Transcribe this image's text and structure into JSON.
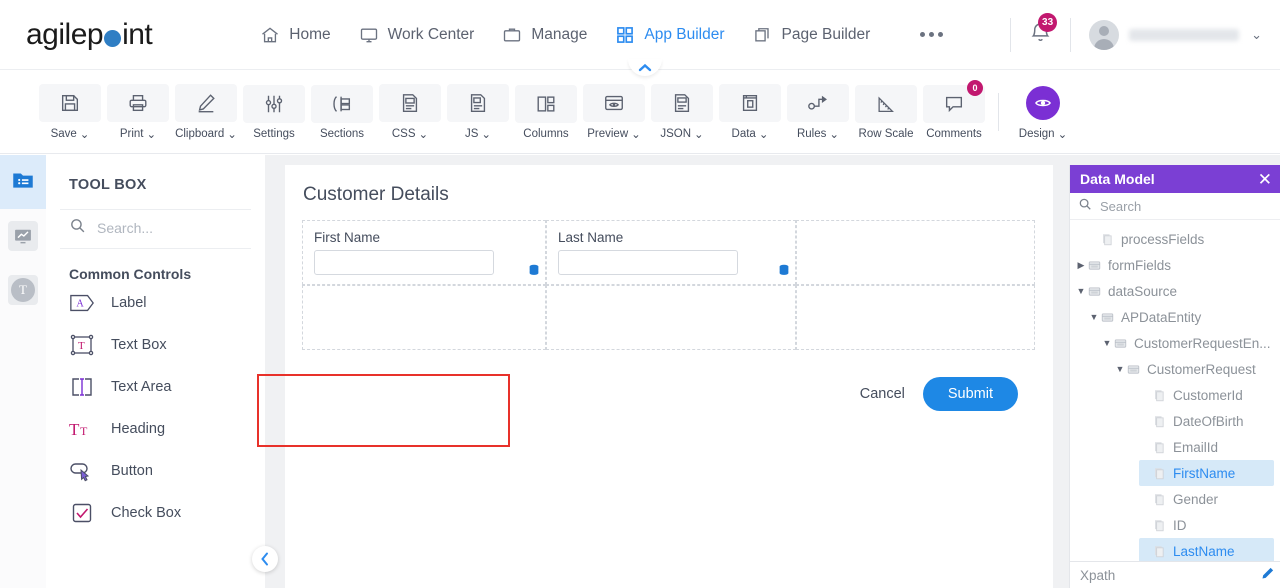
{
  "topnav": {
    "logo_text_a": "agilep",
    "logo_text_b": "int",
    "items": [
      {
        "label": "Home",
        "icon": "home-icon",
        "active": false
      },
      {
        "label": "Work Center",
        "icon": "monitor-icon",
        "active": false
      },
      {
        "label": "Manage",
        "icon": "briefcase-icon",
        "active": false
      },
      {
        "label": "App Builder",
        "icon": "grid-icon",
        "active": true
      },
      {
        "label": "Page Builder",
        "icon": "pages-icon",
        "active": false
      }
    ],
    "more_label": "•••",
    "notification_count": "33",
    "user_name": "",
    "user_caret": "⌄"
  },
  "toolbar": {
    "items": [
      {
        "label": "Save",
        "icon": "save-icon",
        "caret": true
      },
      {
        "label": "Print",
        "icon": "printer-icon",
        "caret": true
      },
      {
        "label": "Clipboard",
        "icon": "pencil-icon",
        "caret": true
      },
      {
        "label": "Settings",
        "icon": "sliders-icon",
        "caret": false
      },
      {
        "label": "Sections",
        "icon": "sections-icon",
        "caret": false
      },
      {
        "label": "CSS",
        "icon": "css-file-icon",
        "caret": true
      },
      {
        "label": "JS",
        "icon": "js-file-icon",
        "caret": true
      },
      {
        "label": "Columns",
        "icon": "columns-icon",
        "caret": false
      },
      {
        "label": "Preview",
        "icon": "eye-window-icon",
        "caret": true
      },
      {
        "label": "JSON",
        "icon": "json-file-icon",
        "caret": true
      },
      {
        "label": "Data",
        "icon": "book-icon",
        "caret": true
      },
      {
        "label": "Rules",
        "icon": "rules-flow-icon",
        "caret": true
      },
      {
        "label": "Row Scale",
        "icon": "ruler-icon",
        "caret": false
      },
      {
        "label": "Comments",
        "icon": "comment-icon",
        "caret": false,
        "badge": "0"
      }
    ],
    "design": {
      "label": "Design",
      "icon": "eye-icon",
      "caret": true
    }
  },
  "rail": {
    "items": [
      {
        "name": "toolbox-rail-icon",
        "active": true
      },
      {
        "name": "chart-rail-icon",
        "active": false
      },
      {
        "name": "theme-rail-icon",
        "active": false,
        "glyph": "T"
      }
    ]
  },
  "toolbox": {
    "title": "TOOL BOX",
    "search_placeholder": "Search...",
    "search_value": "",
    "section_title": "Common Controls",
    "controls": [
      {
        "label": "Label",
        "icon": "label-tag-icon"
      },
      {
        "label": "Text Box",
        "icon": "textbox-icon"
      },
      {
        "label": "Text Area",
        "icon": "textarea-icon"
      },
      {
        "label": "Heading",
        "icon": "heading-icon"
      },
      {
        "label": "Button",
        "icon": "button-icon"
      },
      {
        "label": "Check Box",
        "icon": "checkbox-icon"
      }
    ]
  },
  "canvas": {
    "form_title": "Customer Details",
    "row1": [
      {
        "label": "First Name",
        "value": "",
        "has_db_icon": true,
        "selected": false
      },
      {
        "label": "Last Name",
        "value": "",
        "has_db_icon": true,
        "selected": true
      },
      {
        "label": "",
        "value": "",
        "has_db_icon": false,
        "selected": false
      }
    ],
    "row2": [
      {
        "label": ""
      },
      {
        "label": ""
      },
      {
        "label": ""
      }
    ],
    "cancel_label": "Cancel",
    "submit_label": "Submit"
  },
  "data_model": {
    "title": "Data Model",
    "close_label": "✕",
    "search_placeholder": "Search",
    "search_value": "",
    "tree": [
      {
        "label": "processFields",
        "indent": 1,
        "arrow": "",
        "highlight": false,
        "icon": "field-icon"
      },
      {
        "label": "formFields",
        "indent": 0,
        "arrow": "▶",
        "highlight": false,
        "icon": "folder-node-icon"
      },
      {
        "label": "dataSource",
        "indent": 0,
        "arrow": "▼",
        "highlight": false,
        "icon": "folder-node-icon"
      },
      {
        "label": "APDataEntity",
        "indent": 1,
        "arrow": "▼",
        "highlight": false,
        "icon": "folder-node-icon"
      },
      {
        "label": "CustomerRequestEn...",
        "indent": 2,
        "arrow": "▼",
        "highlight": false,
        "icon": "folder-node-icon"
      },
      {
        "label": "CustomerRequest",
        "indent": 3,
        "arrow": "▼",
        "highlight": false,
        "icon": "folder-node-icon"
      },
      {
        "label": "CustomerId",
        "indent": 5,
        "arrow": "",
        "highlight": false,
        "icon": "field-icon"
      },
      {
        "label": "DateOfBirth",
        "indent": 5,
        "arrow": "",
        "highlight": false,
        "icon": "field-icon"
      },
      {
        "label": "EmailId",
        "indent": 5,
        "arrow": "",
        "highlight": false,
        "icon": "field-icon"
      },
      {
        "label": "FirstName",
        "indent": 5,
        "arrow": "",
        "highlight": true,
        "icon": "field-icon"
      },
      {
        "label": "Gender",
        "indent": 5,
        "arrow": "",
        "highlight": false,
        "icon": "field-icon"
      },
      {
        "label": "ID",
        "indent": 5,
        "arrow": "",
        "highlight": false,
        "icon": "field-icon"
      },
      {
        "label": "LastName",
        "indent": 5,
        "arrow": "",
        "highlight": true,
        "icon": "field-icon"
      }
    ],
    "xpath_label": "Xpath"
  },
  "colors": {
    "accent_blue": "#2d8cf0",
    "submit_blue": "#1e88e5",
    "panel_purple": "#7b3fd4",
    "badge_pink": "#c2186f",
    "selection_red": "#e8312a",
    "highlight_blue": "#d6e9f8"
  }
}
